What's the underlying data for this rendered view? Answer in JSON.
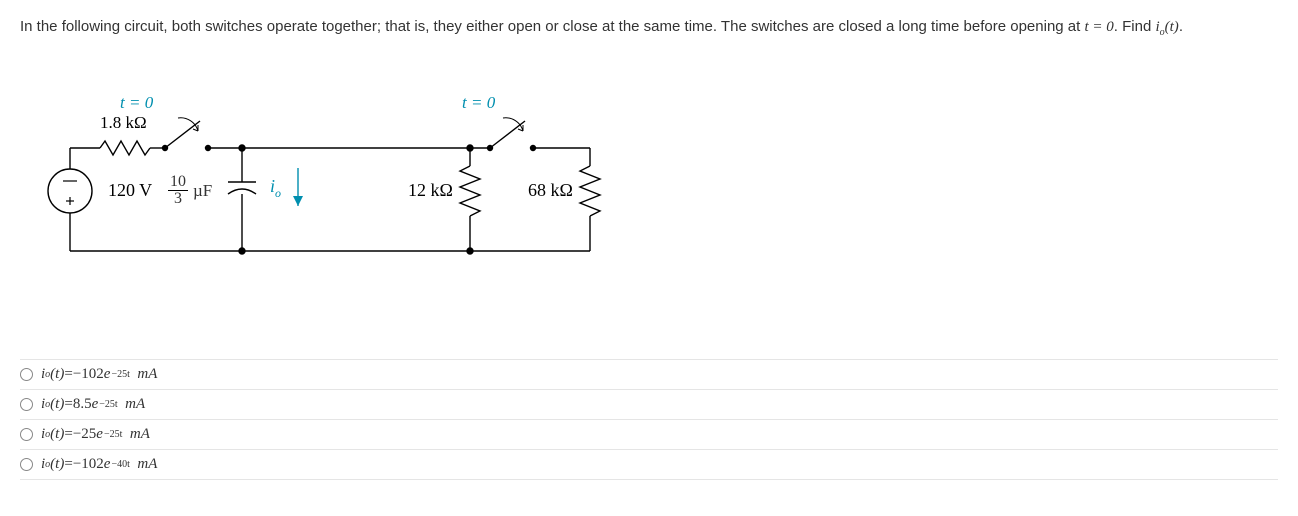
{
  "problem": {
    "prefix": "In the following circuit, both switches operate together; that is, they either open or close at the same time. The switches are closed a long time before opening at ",
    "time_eq": "t = 0",
    "suffix1": ". Find ",
    "find_var": "i",
    "find_sub": "o",
    "find_arg": "(t)",
    "suffix2": "."
  },
  "circuit": {
    "sw1_label": "t = 0",
    "r_series": "1.8 kΩ",
    "vsrc": "120 V",
    "cap_num": "10",
    "cap_den": "3",
    "cap_unit": "µF",
    "io_label_i": "i",
    "io_label_o": "o",
    "r_12k": "12 kΩ",
    "sw2_label": "t = 0",
    "r_68k": "68 kΩ"
  },
  "options": [
    {
      "var": "i",
      "sub": "o",
      "arg": "(t)",
      "eq": " = ",
      "coef": "−102",
      "exp": "−25t",
      "unit": "  mA"
    },
    {
      "var": "i",
      "sub": "o",
      "arg": "(t)",
      "eq": " = ",
      "coef": "8.5",
      "exp": "−25t",
      "unit": "  mA"
    },
    {
      "var": "i",
      "sub": "o",
      "arg": "(t)",
      "eq": " = ",
      "coef": "−25",
      "exp": "−25t",
      "unit": "  mA"
    },
    {
      "var": "i",
      "sub": "o",
      "arg": "(t)",
      "eq": " = ",
      "coef": "−102",
      "exp": "−40t",
      "unit": "  mA"
    }
  ]
}
